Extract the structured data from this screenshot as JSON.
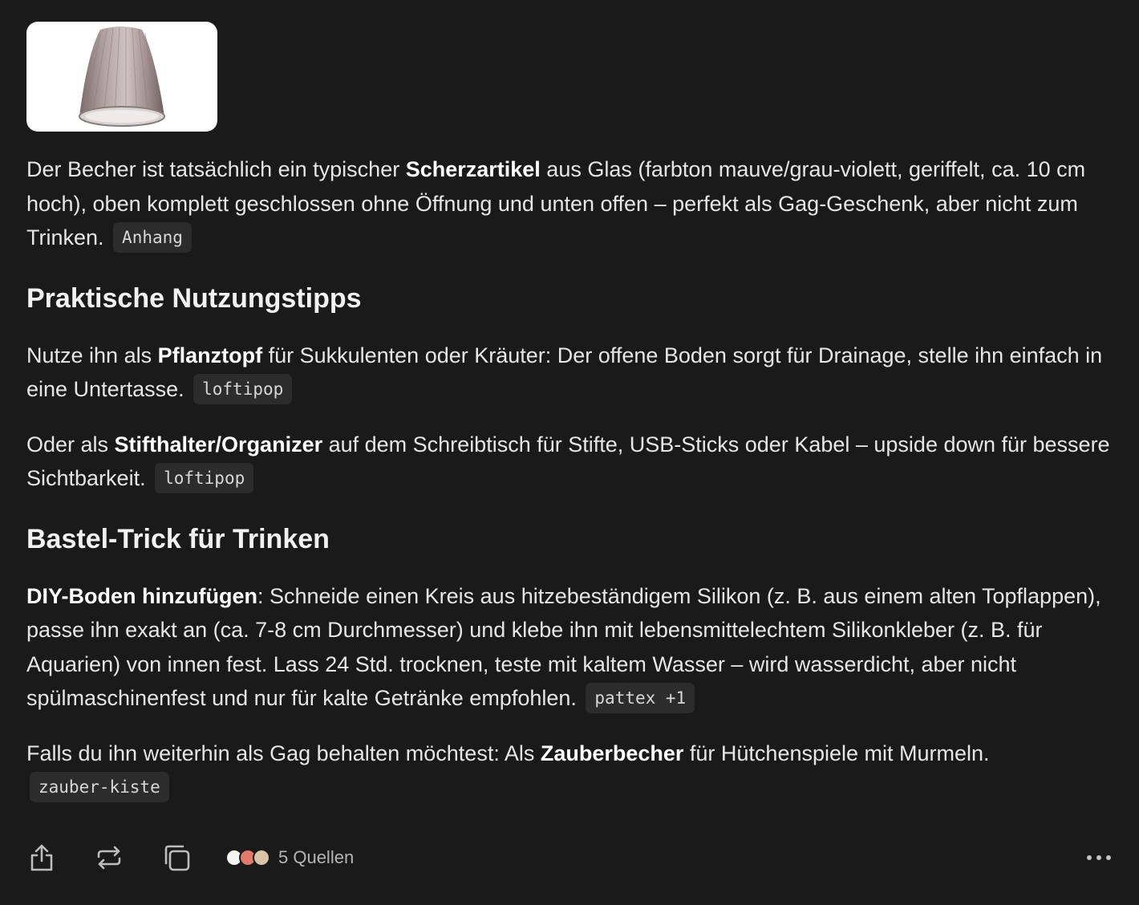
{
  "attachment": {
    "icon": "glass-cup-image"
  },
  "paragraph1": {
    "pre": "Der Becher ist tatsächlich ein typischer ",
    "bold": "Scherzartikel",
    "post": " aus Glas (farbton mauve/grau-violett, geriffelt, ca. 10 cm hoch), oben komplett geschlossen ohne Öffnung und unten offen – perfekt als Gag-Geschenk, aber nicht zum Trinken.",
    "chip": "Anhang"
  },
  "heading1": "Praktische Nutzungstipps",
  "paragraph2": {
    "pre": "Nutze ihn als ",
    "bold": "Pflanztopf",
    "post": " für Sukkulenten oder Kräuter: Der offene Boden sorgt für Drainage, stelle ihn einfach in eine Untertasse.",
    "chip": "loftipop"
  },
  "paragraph3": {
    "pre": "Oder als ",
    "bold": "Stifthalter/Organizer",
    "post": " auf dem Schreibtisch für Stifte, USB-Sticks oder Kabel – upside down für bessere Sichtbarkeit.",
    "chip": "loftipop"
  },
  "heading2": "Bastel-Trick für Trinken",
  "paragraph4": {
    "bold": "DIY-Boden hinzufügen",
    "post": ": Schneide einen Kreis aus hitzebeständigem Silikon (z. B. aus einem alten Topflappen), passe ihn exakt an (ca. 7-8 cm Durchmesser) und klebe ihn mit lebensmittelechtem Silikonkleber (z. B. für Aquarien) von innen fest. Lass 24 Std. trocknen, teste mit kaltem Wasser – wird wasserdicht, aber nicht spülmaschinenfest und nur für kalte Getränke empfohlen.",
    "chip": "pattex +1"
  },
  "paragraph5": {
    "pre": "Falls du ihn weiterhin als Gag behalten möchtest: Als ",
    "bold": "Zauberbecher",
    "post": " für Hütchenspiele mit Murmeln.",
    "chip": "zauber-kiste"
  },
  "footer": {
    "share_icon": "share-icon",
    "regenerate_icon": "regenerate-icon",
    "copy_icon": "copy-icon",
    "sources_label": "5 Quellen",
    "more_icon": "more-icon"
  },
  "colors": {
    "background": "#1a1a1b",
    "text": "#e6e6e6",
    "chip_bg": "#2c2c2d",
    "source_avatars": [
      "#f4f4f4",
      "#e07a6a",
      "#d9c4a6"
    ]
  }
}
